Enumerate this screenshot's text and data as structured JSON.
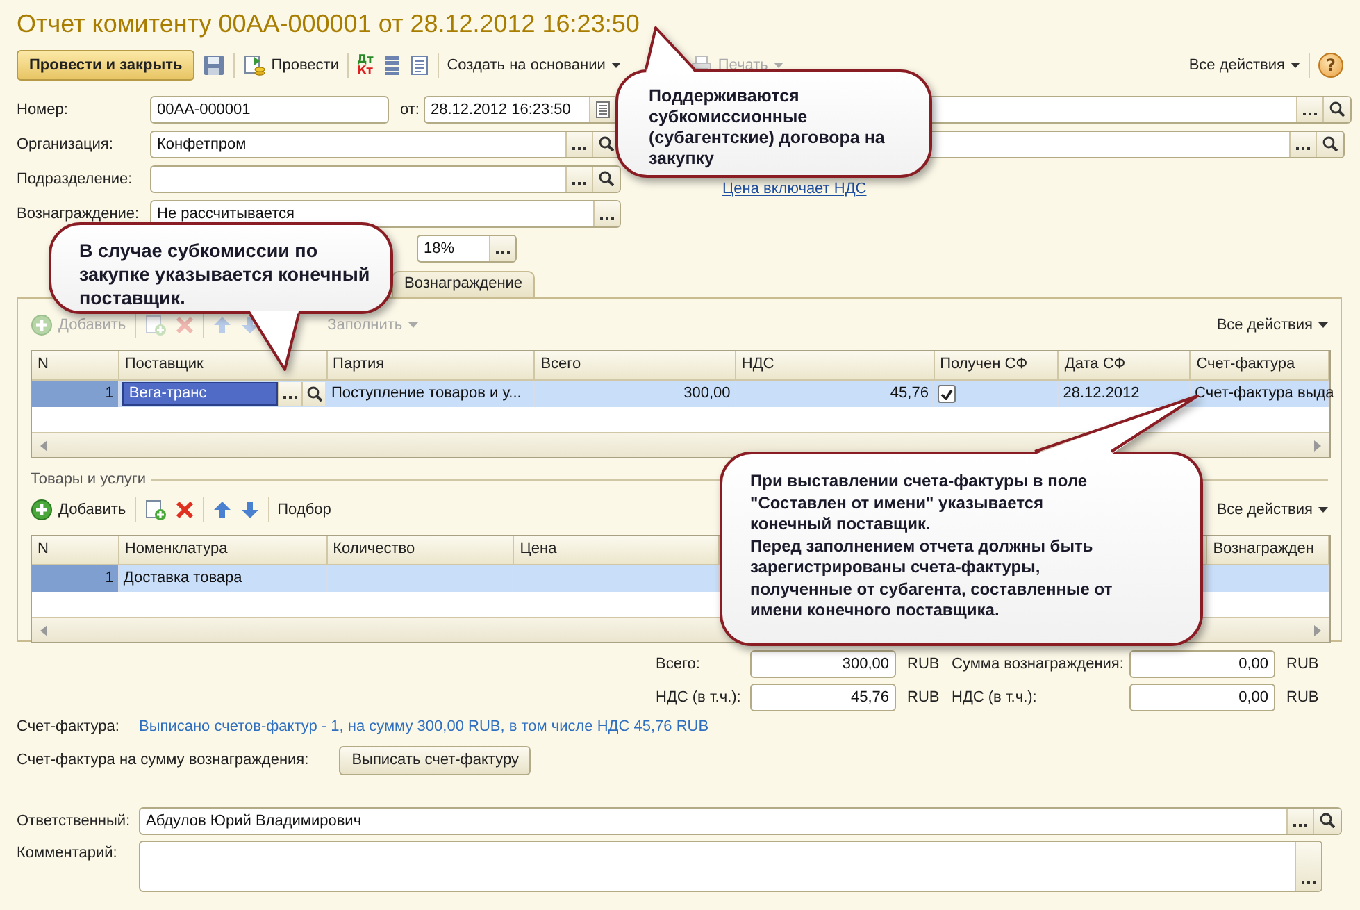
{
  "title": "Отчет комитенту 00АА-000001 от 28.12.2012 16:23:50",
  "toolbar": {
    "post_close": "Провести и закрыть",
    "post": "Провести",
    "dt": "Дт",
    "kt": "Кт",
    "create_based": "Создать на основании",
    "print": {
      "label": "Печать",
      "disabled": true
    },
    "all_actions": "Все действия",
    "help": "?"
  },
  "header": {
    "number": {
      "label": "Номер:",
      "value": "00АА-000001"
    },
    "date": {
      "label": "от:",
      "value": "28.12.2012 16:23:50"
    },
    "organization": {
      "label": "Организация:",
      "value": "Конфетпром"
    },
    "department": {
      "label": "Подразделение:"
    },
    "reward": {
      "label": "Вознаграждение:",
      "value": "Не рассчитывается"
    },
    "reward_vat": {
      "value": "18%"
    },
    "price_link": "Цена включает НДС"
  },
  "tabs": [
    {
      "label": "Вознаграждение",
      "selected": false
    }
  ],
  "suppliers_toolbar": {
    "add": {
      "label": "Добавить",
      "disabled": true
    },
    "fill": {
      "label": "Заполнить",
      "disabled": true
    },
    "all_actions": "Все действия"
  },
  "suppliers_table": {
    "columns": [
      {
        "label": "N"
      },
      {
        "label": "Поставщик"
      },
      {
        "label": "Партия"
      },
      {
        "label": "Всего"
      },
      {
        "label": "НДС"
      },
      {
        "label": "Получен СФ"
      },
      {
        "label": "Дата СФ"
      },
      {
        "label": "Счет-фактура"
      }
    ],
    "rows": [
      {
        "selected": true,
        "n": "1",
        "supplier": "Вега-транс",
        "batch": "Поступление товаров и у...",
        "total": "300,00",
        "vat": "45,76",
        "invoice_received": true,
        "invoice_date": "28.12.2012",
        "invoice": "Счет-фактура выда"
      }
    ]
  },
  "goods_group": {
    "title": "Товары и услуги",
    "toolbar": {
      "add": "Добавить",
      "pick": "Подбор",
      "all_actions": "Все действия"
    },
    "table": {
      "columns": [
        {
          "label": "N"
        },
        {
          "label": "Номенклатура"
        },
        {
          "label": "Количество"
        },
        {
          "label": "Цена"
        },
        {
          "label": "Вознагражден"
        }
      ],
      "rows": [
        {
          "selected": true,
          "n": "1",
          "name": "Доставка товара"
        }
      ]
    }
  },
  "totals": [
    {
      "label": "Всего:",
      "value": "300,00",
      "currency": "RUB"
    },
    {
      "label": "Сумма вознаграждения:",
      "value": "0,00",
      "currency": "RUB"
    },
    {
      "label": "НДС (в т.ч.):",
      "value": "45,76",
      "currency": "RUB"
    },
    {
      "label": "НДС (в т.ч.):",
      "value": "0,00",
      "currency": "RUB"
    }
  ],
  "invoice": {
    "label": "Счет-фактура:",
    "link": "Выписано счетов-фактур - 1, на сумму 300,00 RUB, в том числе НДС 45,76 RUB"
  },
  "reward_invoice": {
    "label": "Счет-фактура на сумму вознаграждения:",
    "button": "Выписать счет-фактуру"
  },
  "responsible": {
    "label": "Ответственный:",
    "value": "Абдулов Юрий Владимирович"
  },
  "comment": {
    "label": "Комментарий:"
  },
  "callouts": [
    {
      "text": "Поддерживаются субкомиссионные (субагентские) договора на закупку"
    },
    {
      "text": "В случае субкомиссии по закупке указывается конечный поставщик."
    },
    {
      "text": "При выставлении счета-фактуры в поле \"Составлен от имени\"  указывается конечный поставщик.\nПеред заполнением отчета должны быть зарегистрированы счета-фактуры, полученные от субагента, составленные от имени конечного поставщика."
    }
  ]
}
